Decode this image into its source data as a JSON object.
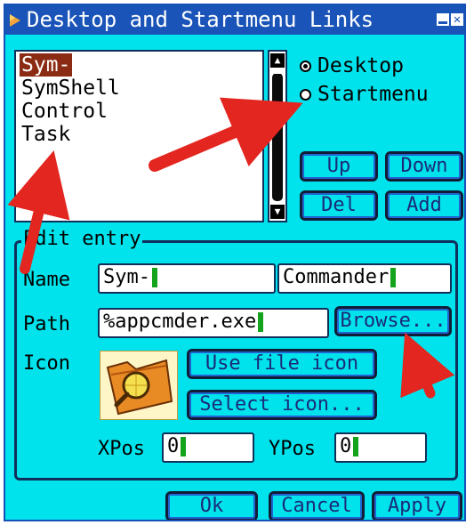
{
  "window": {
    "title": "Desktop and Startmenu Links",
    "controls": {
      "minimize": "",
      "close": "✕"
    }
  },
  "list": {
    "items": [
      {
        "label": "Sym-",
        "selected": true
      },
      {
        "label": "SymShell",
        "selected": false
      },
      {
        "label": "Control",
        "selected": false
      },
      {
        "label": "Task",
        "selected": false
      }
    ]
  },
  "scrollbar": {
    "up": "▲",
    "down": "▼"
  },
  "target": {
    "options": [
      {
        "label": "Desktop",
        "checked": true
      },
      {
        "label": "Startmenu",
        "checked": false
      }
    ]
  },
  "list_buttons": {
    "up": "Up",
    "down": "Down",
    "del": "Del",
    "add": "Add"
  },
  "edit": {
    "group_title": "Edit entry",
    "name_label": "Name",
    "name_value_1": "Sym-",
    "name_value_2": "Commander",
    "path_label": "Path",
    "path_value": "%appcmder.exe",
    "browse": "Browse...",
    "icon_label": "Icon",
    "use_file_icon": "Use file icon",
    "select_icon": "Select icon...",
    "xpos_label": "XPos",
    "xpos_value": "0",
    "ypos_label": "YPos",
    "ypos_value": "0"
  },
  "footer": {
    "ok": "Ok",
    "cancel": "Cancel",
    "apply": "Apply"
  },
  "colors": {
    "window_bg": "#00e3ec",
    "titlebar": "#1a54b8",
    "selection": "#8c2b13",
    "annotation_arrow": "#e3261f",
    "caret": "#14a31c"
  }
}
